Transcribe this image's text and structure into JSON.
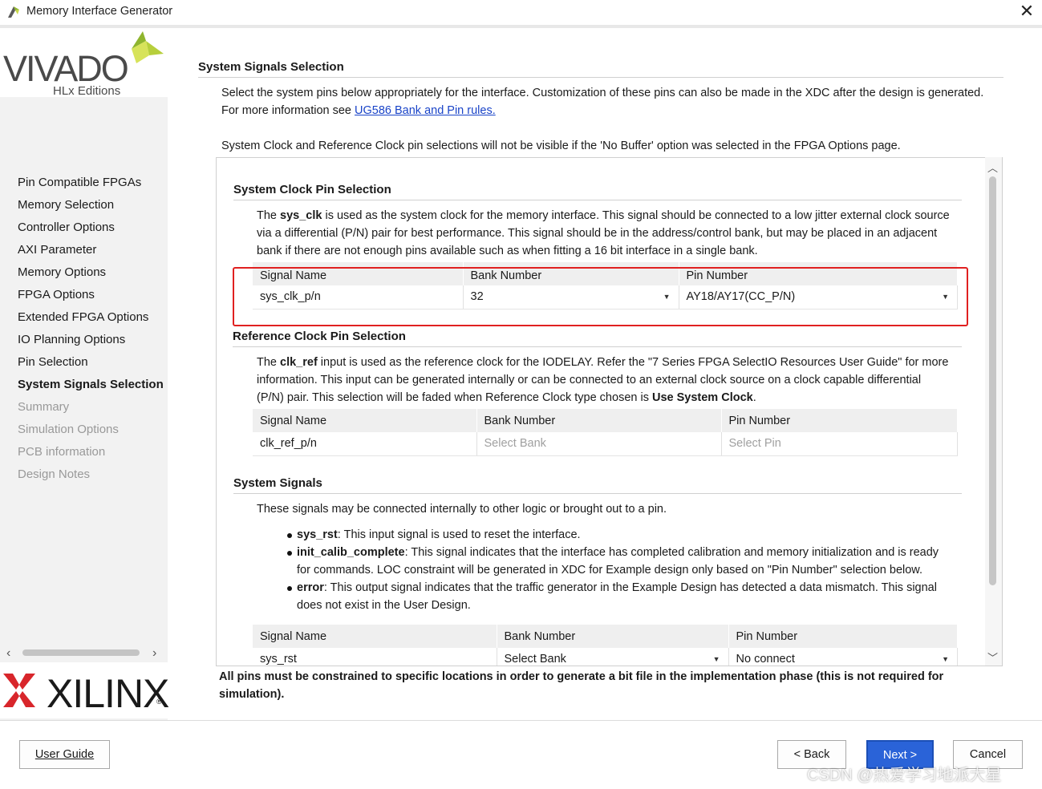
{
  "window": {
    "title": "Memory Interface Generator",
    "close_glyph": "✕"
  },
  "logos": {
    "vivado_word": "VIVADO",
    "vivado_edition": "HLx Editions",
    "xilinx_word": "XILINX",
    "registered": "®"
  },
  "sidebar": {
    "items": [
      {
        "label": "Pin Compatible FPGAs",
        "state": "normal"
      },
      {
        "label": "Memory Selection",
        "state": "normal"
      },
      {
        "label": "Controller Options",
        "state": "normal"
      },
      {
        "label": "AXI Parameter",
        "state": "normal"
      },
      {
        "label": "Memory Options",
        "state": "normal"
      },
      {
        "label": "FPGA Options",
        "state": "normal"
      },
      {
        "label": "Extended FPGA Options",
        "state": "normal"
      },
      {
        "label": "IO Planning Options",
        "state": "normal"
      },
      {
        "label": "Pin Selection",
        "state": "normal"
      },
      {
        "label": "System Signals Selection",
        "state": "active"
      },
      {
        "label": "Summary",
        "state": "disabled"
      },
      {
        "label": "Simulation Options",
        "state": "disabled"
      },
      {
        "label": "PCB information",
        "state": "disabled"
      },
      {
        "label": "Design Notes",
        "state": "disabled"
      }
    ]
  },
  "page": {
    "title": "System Signals Selection",
    "intro_1": "Select the system pins below appropriately for the interface. Customization of these pins can also be made in the XDC after the design is generated.",
    "intro_2_prefix": "For more information see ",
    "intro_link": "UG586 Bank and Pin rules.",
    "note": "System Clock and Reference Clock pin selections will not be visible if the 'No Buffer' option was selected in the FPGA Options page.",
    "footer_warning": "All pins must be constrained to specific locations in order to generate a bit file in the implementation phase (this is not required for simulation)."
  },
  "sys_clock": {
    "title": "System Clock Pin Selection",
    "desc_pre": "The ",
    "desc_bold": "sys_clk",
    "desc_post": " is used as the system clock for the memory interface. This signal should be connected to a low jitter external clock source via a differential (P/N) pair for best performance. This signal should be in the address/control bank, but may be placed in an adjacent bank if there are not enough pins available such as when fitting a 16 bit interface in a single bank.",
    "headers": [
      "Signal Name",
      "Bank Number",
      "Pin Number"
    ],
    "row": {
      "signal": "sys_clk_p/n",
      "bank": "32",
      "pin": "AY18/AY17(CC_P/N)"
    }
  },
  "ref_clock": {
    "title": "Reference Clock Pin Selection",
    "desc_pre": "The ",
    "desc_bold": "clk_ref",
    "desc_mid": " input is used as the reference clock for the IODELAY. Refer the \"7 Series FPGA SelectIO Resources User Guide\" for more information. This input can be generated internally or can be connected to an external clock source on a clock capable differential (P/N) pair. This selection will be faded when Reference Clock type chosen is ",
    "desc_bold2": "Use System Clock",
    "desc_end": ".",
    "headers": [
      "Signal Name",
      "Bank Number",
      "Pin Number"
    ],
    "row": {
      "signal": "clk_ref_p/n",
      "bank": "Select Bank",
      "pin": "Select Pin"
    }
  },
  "sys_signals": {
    "title": "System Signals",
    "desc": "These signals may be connected internally to other logic or brought out to a pin.",
    "bullets": [
      {
        "name": "sys_rst",
        "text": ": This input signal is used to reset the interface."
      },
      {
        "name": "init_calib_complete",
        "text": ": This signal indicates that the interface has completed calibration and memory initialization and is ready for commands. LOC constraint will be generated in XDC for Example design only based on \"Pin Number\" selection below."
      },
      {
        "name": "error",
        "text": ": This output signal indicates that the traffic generator in the Example Design has detected a data mismatch. This signal does not exist in the User Design."
      }
    ],
    "headers": [
      "Signal Name",
      "Bank Number",
      "Pin Number"
    ],
    "row": {
      "signal": "sys_rst",
      "bank": "Select Bank",
      "pin": "No connect"
    }
  },
  "buttons": {
    "user_guide": "User Guide",
    "back": "< Back",
    "next": "Next >",
    "cancel": "Cancel"
  },
  "watermark": "CSDN @热爱学习地派大星"
}
